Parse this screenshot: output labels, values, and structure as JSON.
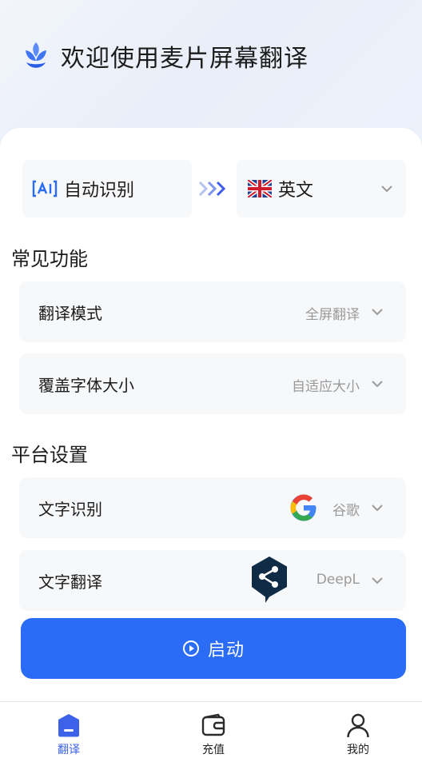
{
  "app": {
    "title": "欢迎使用麦片屏幕翻译",
    "logo": "leaf-logo-icon"
  },
  "language": {
    "source_label": "自动识别",
    "source_icon": "ai-icon",
    "target_label": "英文",
    "target_icon": "uk-flag-icon"
  },
  "common": {
    "title": "常见功能",
    "items": [
      {
        "label": "翻译模式",
        "value": "全屏翻译"
      },
      {
        "label": "覆盖字体大小",
        "value": "自适应大小"
      }
    ]
  },
  "platform": {
    "title": "平台设置",
    "items": [
      {
        "label": "文字识别",
        "value": "谷歌",
        "icon": "google-icon"
      },
      {
        "label": "文字翻译",
        "value": "DeepL",
        "icon": "deepl-icon"
      }
    ]
  },
  "start_button": {
    "label": "启动"
  },
  "tabbar": {
    "items": [
      {
        "label": "翻译",
        "icon": "translate-tab-icon",
        "active": true
      },
      {
        "label": "充值",
        "icon": "wallet-icon",
        "active": false
      },
      {
        "label": "我的",
        "icon": "user-icon",
        "active": false
      }
    ]
  },
  "colors": {
    "accent": "#2a6cf6",
    "tab_active": "#3b62e8",
    "muted_text": "#9a9a9a"
  }
}
